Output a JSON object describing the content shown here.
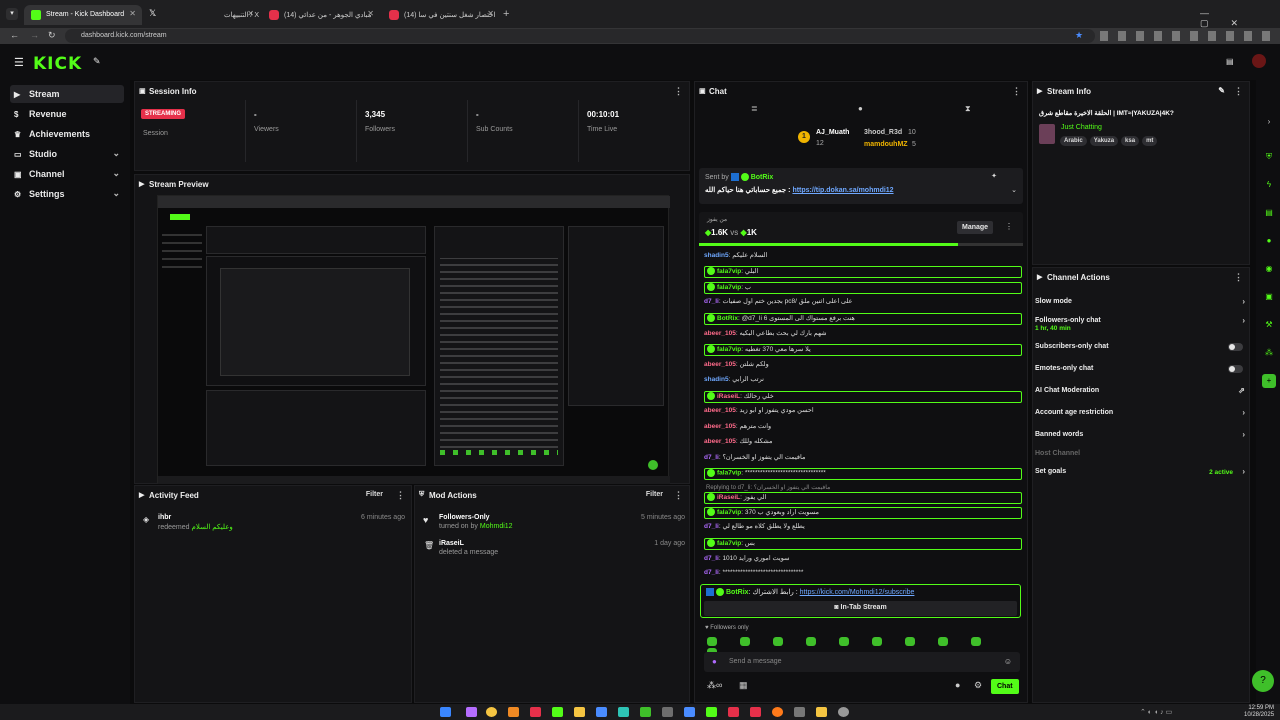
{
  "browser": {
    "tabs": [
      {
        "title": "Stream - Kick Dashboard",
        "active": true,
        "color": "#53fc18"
      },
      {
        "title": "التنبيهات / X",
        "active": false,
        "color": "#ffffff"
      },
      {
        "title": "(14) مبادي الجوهر - من عدائي",
        "active": false,
        "color": "#e5304a"
      },
      {
        "title": "(14) اختصار شغل سنتين في سا",
        "active": false,
        "color": "#e5304a"
      }
    ],
    "url": "dashboard.kick.com/stream"
  },
  "app": {
    "logo": "KICK"
  },
  "sidebar": {
    "items": [
      {
        "label": "Stream",
        "icon": "play-icon",
        "active": true
      },
      {
        "label": "Revenue",
        "icon": "dollar-icon"
      },
      {
        "label": "Achievements",
        "icon": "trophy-icon"
      },
      {
        "label": "Studio",
        "icon": "monitor-icon",
        "chevron": true
      },
      {
        "label": "Channel",
        "icon": "channel-icon",
        "chevron": true
      },
      {
        "label": "Settings",
        "icon": "gear-icon",
        "chevron": true
      }
    ]
  },
  "session": {
    "title": "Session Info",
    "status": "STREAMING",
    "stats": [
      {
        "value": "",
        "label": "Session"
      },
      {
        "value": "-",
        "label": "Viewers"
      },
      {
        "value": "3,345",
        "label": "Followers"
      },
      {
        "value": "-",
        "label": "Sub Counts"
      },
      {
        "value": "00:10:01",
        "label": "Time Live"
      }
    ]
  },
  "preview": {
    "title": "Stream Preview"
  },
  "activity": {
    "title": "Activity Feed",
    "filter": "Filter",
    "items": [
      {
        "user": "ihbr",
        "action": "redeemed",
        "reward": "وعليكم السلام",
        "time": "6 minutes ago"
      }
    ]
  },
  "mod": {
    "title": "Mod Actions",
    "filter": "Filter",
    "items": [
      {
        "title": "Followers-Only",
        "desc": "turned on by",
        "by": "Mohmdi12",
        "time": "5 minutes ago"
      },
      {
        "title": "iRaseiL",
        "desc": "deleted a message",
        "by": "",
        "time": "1 day ago"
      }
    ]
  },
  "chat": {
    "title": "Chat",
    "top_gifters": [
      {
        "name": "AJ_Muath",
        "count": "12"
      },
      {
        "name": "3hood_R3d",
        "count": "10"
      },
      {
        "name": "mamdouhMZ",
        "count": "5"
      }
    ],
    "pinned": {
      "sent_by": "Sent by",
      "user": "BotRix",
      "text": "جميع حساباتي هنا حياكم الله :",
      "link": "https://tip.dokan.sa/mohmdi12"
    },
    "poll": {
      "label": "من يفوز",
      "left": "1.6K",
      "vs": "vs",
      "right": "1K",
      "manage": "Manage"
    },
    "messages": [
      {
        "user": "shadin5",
        "text": "السلام عليكم",
        "color": "#6fa8ff"
      },
      {
        "user": "fala7vip",
        "text": "البلي",
        "color": "#53fc18",
        "badge": true,
        "hl": true
      },
      {
        "user": "fala7vip",
        "text": "ب",
        "color": "#53fc18",
        "badge": true,
        "hl": true
      },
      {
        "user": "d7_li",
        "text": "بجدين ختم اول صفيات pc8/ على اعلى اثنين ملق",
        "color": "#b06bff"
      },
      {
        "user": "BotRix",
        "text": "@d7_li هنت برفع مستواك الى المستوى 6",
        "color": "#53fc18",
        "badge": true,
        "hl": true
      },
      {
        "user": "abeer_105",
        "text": "شهم بارك لي بحث بطاعي البكيه",
        "color": "#ff6b8b"
      },
      {
        "user": "fala7vip",
        "text": "يلا سرها معي 370 تغطيه",
        "color": "#53fc18",
        "badge": true,
        "hl": true
      },
      {
        "user": "abeer_105",
        "text": "ولكم شلتن",
        "color": "#ff6b8b"
      },
      {
        "user": "shadin5",
        "text": "نرتب الرابي",
        "color": "#6fa8ff"
      },
      {
        "user": "iRaseiL",
        "text": "خلي رحالك",
        "color": "#ff6b8b",
        "badge": true,
        "hl": true
      },
      {
        "user": "abeer_105",
        "text": "احسن مودي يتفوز او ابو زيد",
        "color": "#ff6b8b"
      },
      {
        "user": "abeer_105",
        "text": "وانت مترهم",
        "color": "#ff6b8b"
      },
      {
        "user": "abeer_105",
        "text": "مشكله وللك",
        "color": "#ff6b8b"
      },
      {
        "user": "d7_li",
        "text": "مافيمت الي يتفوز او الخسران؟",
        "color": "#b06bff"
      },
      {
        "user": "fala7vip",
        "text": "********************************",
        "color": "#53fc18",
        "badge": true,
        "hl": true
      },
      {
        "user": "iRaseiL",
        "text": "الي يفوز",
        "color": "#ff6b8b",
        "badge": true,
        "hl": true
      },
      {
        "user": "fala7vip",
        "text": "مسويت اراد وبعودي ب 370",
        "color": "#53fc18",
        "badge": true,
        "hl": true
      },
      {
        "user": "d7_li",
        "text": "يطلع ولا يطلق كلاه مو طالع لي",
        "color": "#b06bff"
      },
      {
        "user": "fala7vip",
        "text": "بس",
        "color": "#53fc18",
        "badge": true,
        "hl": true
      },
      {
        "user": "d7_li",
        "text": "1010 سويت اموري ورايد",
        "color": "#b06bff"
      },
      {
        "user": "d7_li",
        "text": "********************************",
        "color": "#b06bff"
      }
    ],
    "replying": "Replying to d7_li: مافيمت الي يتفوز او الخسران؟",
    "botrix_final": {
      "user": "BotRix",
      "text": "رابط الاشتراك :",
      "link": "https://kick.com/Mohmdi12/subscribe"
    },
    "in_tab": "In-Tab Stream",
    "followers_only": "Followers only",
    "placeholder": "Send a message",
    "send": "Chat"
  },
  "stream_info": {
    "title": "Stream Info",
    "stream_title": "الحلقة الاخيرة مقاطع شرق | IMT≈|YAKUZA|4K?",
    "category": "Just Chatting",
    "tags": [
      "Arabic",
      "Yakuza",
      "ksa",
      "mt"
    ]
  },
  "channel_actions": {
    "title": "Channel Actions",
    "items": [
      {
        "label": "Slow mode",
        "type": "chevron"
      },
      {
        "label": "Followers-only chat",
        "sub": "1 hr, 40 min",
        "type": "chevron"
      },
      {
        "label": "Subscribers-only chat",
        "type": "toggle"
      },
      {
        "label": "Emotes-only chat",
        "type": "toggle"
      },
      {
        "label": "AI Chat Moderation",
        "type": "external"
      },
      {
        "label": "Account age restriction",
        "type": "chevron"
      },
      {
        "label": "Banned words",
        "type": "chevron"
      },
      {
        "label": "Host Channel",
        "type": "disabled"
      },
      {
        "label": "Set goals",
        "sub": "2 active",
        "type": "chevron"
      }
    ]
  },
  "taskbar": {
    "time": "12:59 PM",
    "date": "10/28/2025"
  }
}
